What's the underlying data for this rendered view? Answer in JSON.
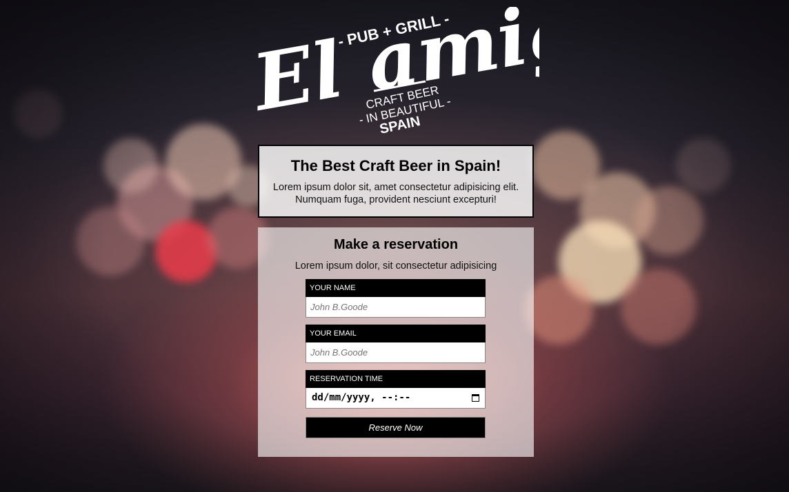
{
  "logo": {
    "line_top": "- PUB + GRILL -",
    "brand": "El amigo",
    "tagline_1": "CRAFT BEER",
    "tagline_2": "- IN BEAUTIFUL -",
    "tagline_3": "SPAIN"
  },
  "hero": {
    "title": "The Best Craft Beer in Spain!",
    "text": "Lorem ipsum dolor sit, amet consectetur adipisicing elit. Numquam fuga, provident nesciunt excepturi!"
  },
  "reservation": {
    "title": "Make a reservation",
    "subtitle": "Lorem ipsum dolor, sit consectetur adipisicing",
    "name_label": "YOUR NAME",
    "name_placeholder": "John B.Goode",
    "email_label": "YOUR EMAIL",
    "email_placeholder": "John B.Goode",
    "time_label": "RESERVATION TIME",
    "time_value": "dd/mm/yyyy, --:--",
    "submit_label": "Reserve Now"
  },
  "icons": {
    "calendar": "calendar-icon"
  },
  "colors": {
    "label_bg": "#000000",
    "button_bg": "#000000",
    "panel_bg": "rgba(255,255,255,0.62)"
  }
}
